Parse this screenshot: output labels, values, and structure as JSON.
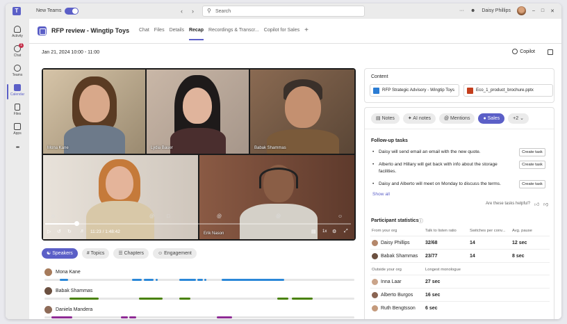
{
  "titlebar": {
    "new_teams_label": "New Teams",
    "search_placeholder": "Search",
    "more": "···",
    "user_name": "Daisy Phillips",
    "win_min": "–",
    "win_max": "□",
    "win_close": "✕"
  },
  "rail": {
    "items": [
      {
        "label": "Activity"
      },
      {
        "label": "Chat",
        "badge": "1"
      },
      {
        "label": "Teams"
      },
      {
        "label": "Calendar"
      },
      {
        "label": "Files"
      },
      {
        "label": "Apps"
      }
    ],
    "more": "•••"
  },
  "meeting": {
    "title": "RFP review - Wingtip Toys",
    "tabs": [
      "Chat",
      "Files",
      "Details",
      "Recap",
      "Recordings & Transcr...",
      "Copilot for Sales"
    ],
    "active_tab": "Recap",
    "date": "Jan 21, 2024 10:00 - 11:00",
    "copilot_label": "Copilot"
  },
  "video": {
    "tiles": [
      {
        "name": "Mona Kane"
      },
      {
        "name": "Lydia Bauer"
      },
      {
        "name": "Babak Shammas"
      },
      {
        "name": ""
      },
      {
        "name": "Erik Nason"
      }
    ],
    "time": "11:23 / 1:48:42",
    "progress_fraction": 0.104
  },
  "recap_tabs": [
    "Speakers",
    "Topics",
    "Chapters",
    "Engagement"
  ],
  "speakers": [
    {
      "name": "Mona Kane",
      "color": "#2b88d8"
    },
    {
      "name": "Babak Shammas",
      "color": "#498205"
    },
    {
      "name": "Daniela Mandera",
      "color": "#8f2b95"
    }
  ],
  "content": {
    "title": "Content",
    "files": [
      "RFP Strategic Advisory - Wingtip Toys",
      "Eco_1_product_brochure.pptx"
    ]
  },
  "notes_tabs": [
    "Notes",
    "AI notes",
    "Mentions",
    "Sales",
    "+2"
  ],
  "followup": {
    "title": "Follow-up tasks",
    "tasks": [
      "Daisy will send email an email with the new quote.",
      "Alberto and Hillary will get back with info about the storage facilities.",
      "Daisy and Alberto will meet on Monday to discuss the terms."
    ],
    "task_button": "Create task",
    "show_all": "Show all",
    "helpful": "Are these tasks helpful?"
  },
  "stats": {
    "title": "Participant statistics",
    "org_headers": [
      "From your org",
      "Talk to listen ratio",
      "Switches per conv...",
      "Avg. pause"
    ],
    "org_rows": [
      {
        "name": "Daisy Phillips",
        "ratio": "32/68",
        "switches": "14",
        "pause": "12 sec"
      },
      {
        "name": "Babak Shammas",
        "ratio": "23/77",
        "switches": "14",
        "pause": "8 sec"
      }
    ],
    "outside_headers": [
      "Outside your org",
      "Longest monologue"
    ],
    "outside_rows": [
      {
        "name": "Inna Laar",
        "value": "27 sec"
      },
      {
        "name": "Alberto Burgos",
        "value": "16 sec"
      },
      {
        "name": "Ruth Bengtsson",
        "value": "6 sec"
      }
    ]
  }
}
